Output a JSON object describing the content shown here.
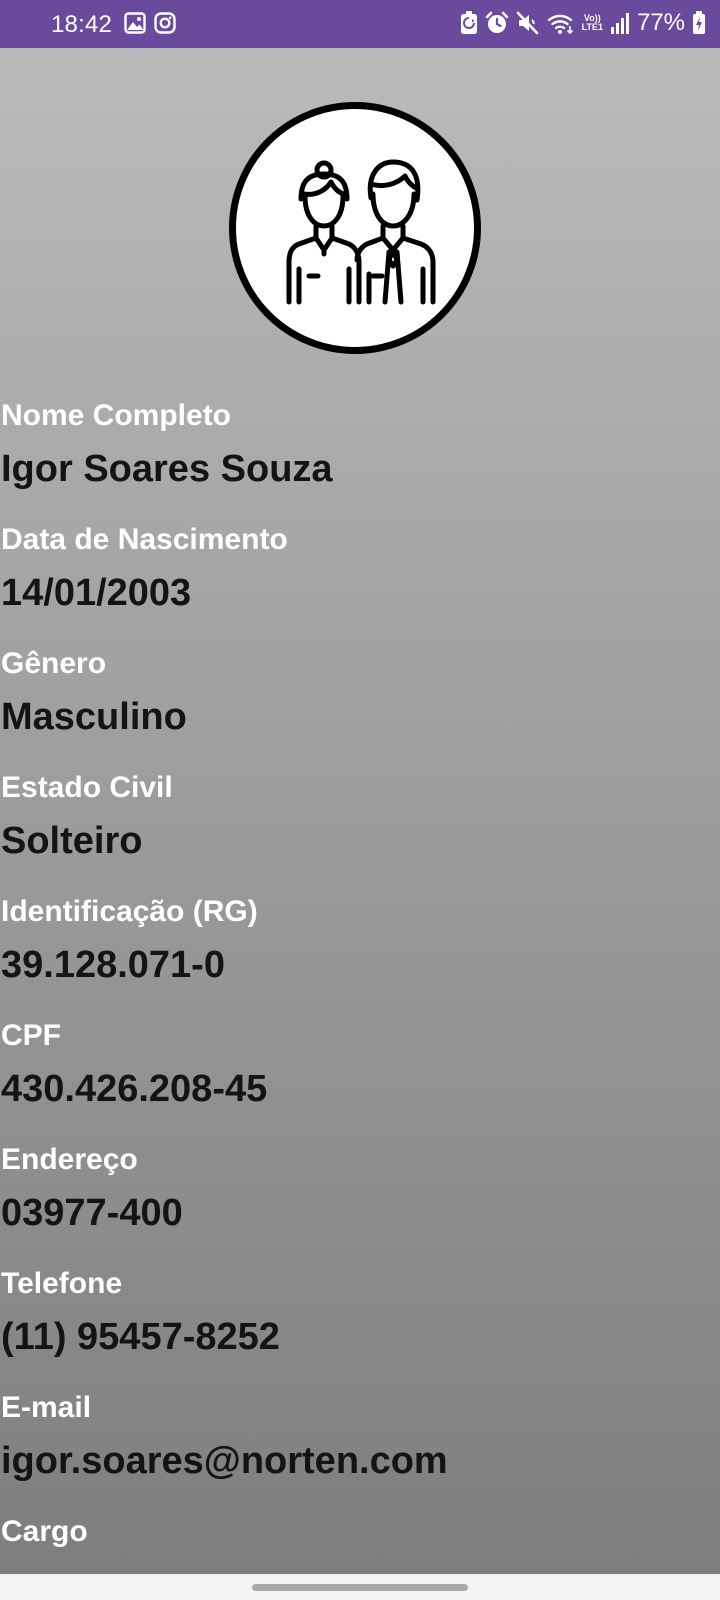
{
  "status_bar": {
    "time": "18:42",
    "network_top": "Vo))",
    "network_bottom": "LTE1",
    "battery": "77%",
    "color": "#6a4a9c"
  },
  "profile": {
    "avatar_icon": "people-couple-icon",
    "fields": [
      {
        "label": "Nome Completo",
        "value": "Igor Soares Souza"
      },
      {
        "label": "Data de Nascimento",
        "value": "14/01/2003"
      },
      {
        "label": "Gênero",
        "value": "Masculino"
      },
      {
        "label": "Estado Civil",
        "value": "Solteiro"
      },
      {
        "label": "Identificação (RG)",
        "value": "39.128.071-0"
      },
      {
        "label": "CPF",
        "value": "430.426.208-45"
      },
      {
        "label": "Endereço",
        "value": "03977-400"
      },
      {
        "label": "Telefone",
        "value": "(11) 95457-8252"
      },
      {
        "label": "E-mail",
        "value": "igor.soares@norten.com"
      },
      {
        "label": "Cargo",
        "value": ""
      }
    ]
  }
}
